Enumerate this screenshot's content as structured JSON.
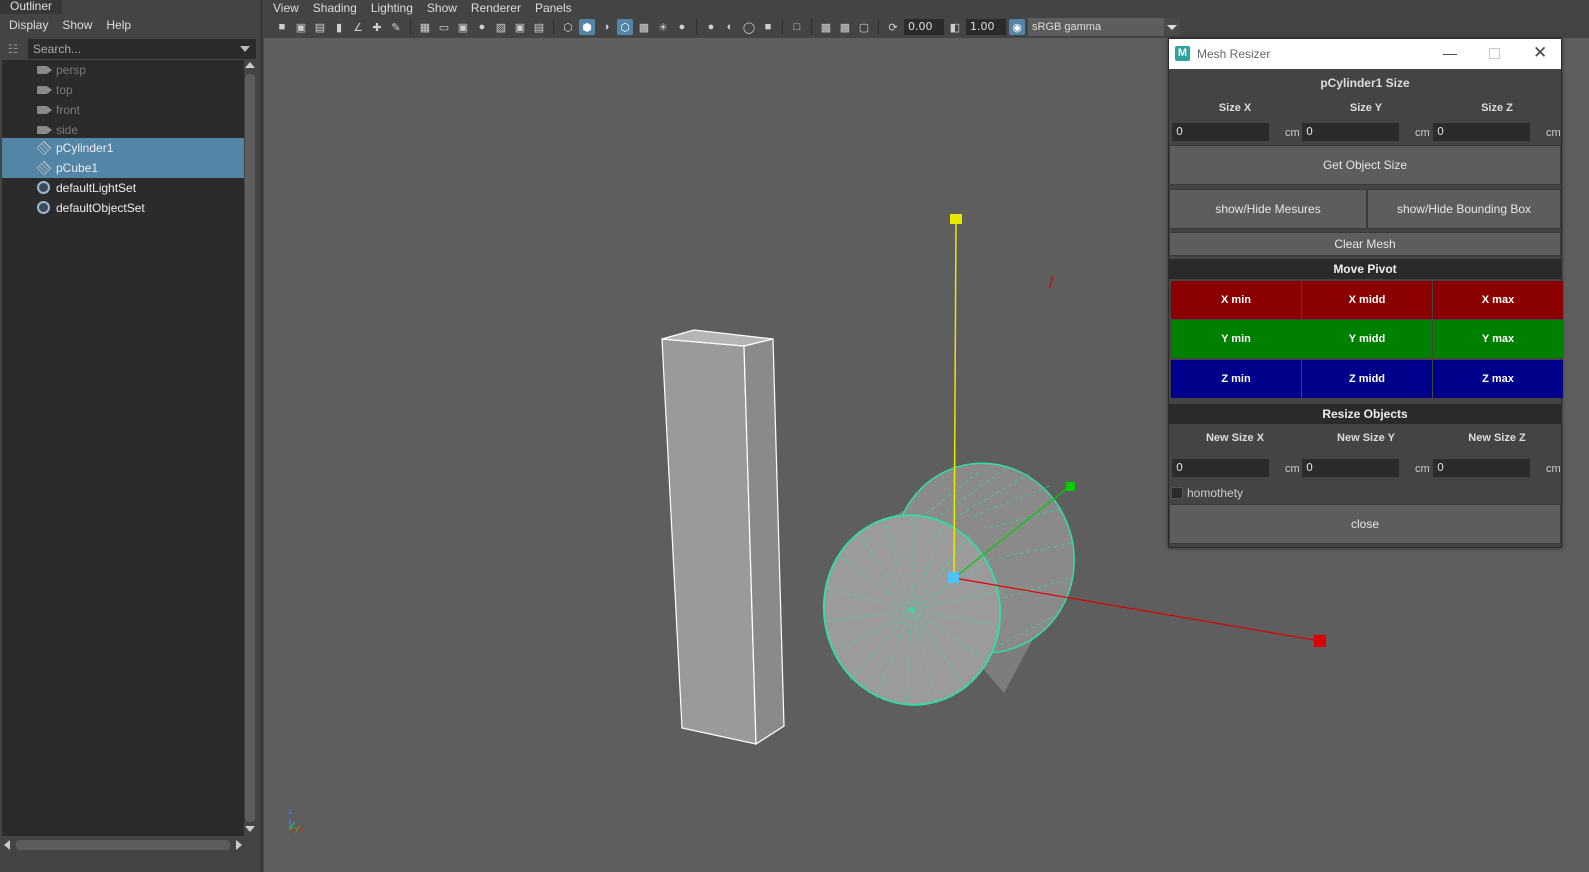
{
  "outliner": {
    "title": "Outliner",
    "menu": [
      "Display",
      "Show",
      "Help"
    ],
    "search_placeholder": "Search...",
    "items": [
      {
        "label": "persp",
        "icon": "camera-icon",
        "state": "dim"
      },
      {
        "label": "top",
        "icon": "camera-icon",
        "state": "dim"
      },
      {
        "label": "front",
        "icon": "camera-icon",
        "state": "dim"
      },
      {
        "label": "side",
        "icon": "camera-icon",
        "state": "dim"
      },
      {
        "label": "pCylinder1",
        "icon": "mesh-icon",
        "state": "selected"
      },
      {
        "label": "pCube1",
        "icon": "mesh-icon",
        "state": "selected"
      },
      {
        "label": "defaultLightSet",
        "icon": "set-icon",
        "state": "normal"
      },
      {
        "label": "defaultObjectSet",
        "icon": "set-icon",
        "state": "normal"
      }
    ]
  },
  "viewport": {
    "menu": [
      "View",
      "Shading",
      "Lighting",
      "Show",
      "Renderer",
      "Panels"
    ],
    "exposure": "0.00",
    "gamma": "1.00",
    "color_space": "sRGB gamma",
    "axis_labels": {
      "x": "x",
      "y": "y",
      "z": "z"
    },
    "colors": {
      "selection": "#5285a6",
      "wire_highlight": "#30e0a0",
      "gizmo_x": "#dd0000",
      "gizmo_y": "#e8e800",
      "gizmo_z": "#00cc00"
    }
  },
  "mesh_resizer": {
    "window_title": "Mesh Resizer",
    "app_icon_letter": "M",
    "size_header": "pCylinder1 Size",
    "size_labels": [
      "Size X",
      "Size Y",
      "Size Z"
    ],
    "size_values": [
      "0",
      "0",
      "0"
    ],
    "unit": "cm",
    "get_size_button": "Get Object Size",
    "show_mesures_button": "show/Hide Mesures",
    "show_bbox_button": "show/Hide Bounding Box",
    "clear_mesh_button": "Clear Mesh",
    "move_pivot_header": "Move Pivot",
    "pivot_buttons": {
      "x": [
        "X min",
        "X midd",
        "X max"
      ],
      "y": [
        "Y min",
        "Y midd",
        "Y max"
      ],
      "z": [
        "Z min",
        "Z midd",
        "Z max"
      ]
    },
    "pivot_colors": {
      "x": "#8b0000",
      "y": "#008000",
      "z": "#00008b"
    },
    "resize_header": "Resize Objects",
    "new_size_labels": [
      "New Size X",
      "New Size Y",
      "New Size Z"
    ],
    "new_size_values": [
      "0",
      "0",
      "0"
    ],
    "homothety_label": "homothety",
    "close_button": "close"
  }
}
